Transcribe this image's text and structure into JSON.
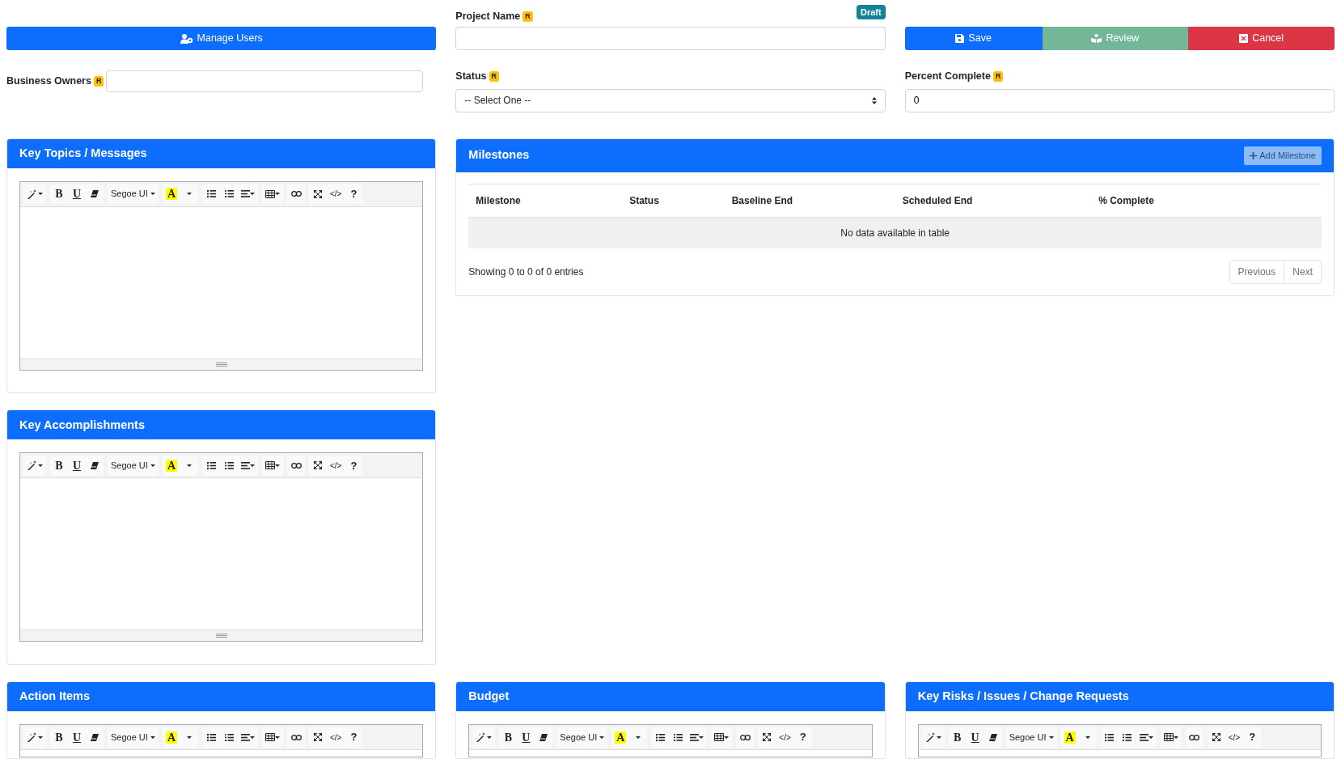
{
  "top": {
    "manage_users": {
      "label": "Manage Users"
    },
    "business_owners": {
      "label": "Business Owners",
      "required": "R"
    },
    "project_name": {
      "label": "Project Name",
      "required": "R",
      "badge": "Draft"
    },
    "actions": [
      {
        "kind": "save",
        "label": "Save",
        "disabled": false
      },
      {
        "kind": "review",
        "label": "Review",
        "disabled": true
      },
      {
        "kind": "cancel",
        "label": "Cancel",
        "disabled": false
      }
    ],
    "status": {
      "label": "Status",
      "required": "R",
      "value": "-- Select One --"
    },
    "percent_complete": {
      "label": "Percent Complete",
      "required": "R",
      "value": "0"
    }
  },
  "key_topics": {
    "title": "Key Topics / Messages",
    "toolbar": {
      "bold": "B",
      "underline": "U",
      "font": "Segoe UI",
      "highlight": "A",
      "code": "</>",
      "help": "?"
    }
  },
  "milestones": {
    "title": "Milestones",
    "add_button": {
      "label": "Add Milestone",
      "disabled": true
    },
    "columns": [
      "Milestone",
      "Status",
      "Baseline End",
      "Scheduled End",
      "% Complete"
    ],
    "empty_message": "No data available in table",
    "info": "Showing 0 to 0 of 0 entries",
    "pagination": [
      {
        "label": "Previous",
        "disabled": true
      },
      {
        "label": "Next",
        "disabled": true
      }
    ]
  },
  "key_accomplishments": {
    "title": "Key Accomplishments",
    "toolbar": {
      "bold": "B",
      "underline": "U",
      "font": "Segoe UI",
      "highlight": "A",
      "code": "</>",
      "help": "?"
    }
  },
  "bottom_sections": [
    {
      "title": "Action Items",
      "toolbar": {
        "bold": "B",
        "underline": "U",
        "font": "Segoe UI",
        "highlight": "A",
        "code": "</>",
        "help": "?"
      }
    },
    {
      "title": "Budget",
      "toolbar": {
        "bold": "B",
        "underline": "U",
        "font": "Segoe UI",
        "highlight": "A",
        "code": "</>",
        "help": "?"
      }
    },
    {
      "title": "Key Risks / Issues / Change Requests",
      "toolbar": {
        "bold": "B",
        "underline": "U",
        "font": "Segoe UI",
        "highlight": "A",
        "code": "</>",
        "help": "?"
      }
    }
  ]
}
